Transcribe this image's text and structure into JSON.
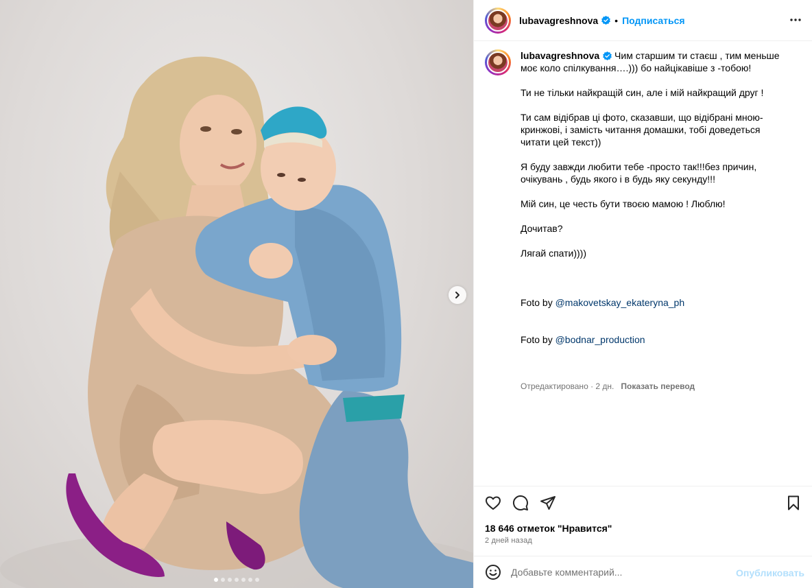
{
  "post": {
    "author": "lubavagreshnova",
    "follow_label": "Подписаться",
    "separator": "•",
    "caption": {
      "first_line": "Чим старшим ти стаєш , тим меньше моє коло спілкування….))) бо найцікавіше з -тобою!",
      "paragraphs": [
        "Ти не тільки найкращій син, але і мій найкращий друг !",
        "Ти сам відібрав ці фото, сказавши, що відібрані мною- кринжові, і замість читання домашки, тобі доведеться читати цей текст))",
        "Я буду завжди любити тебе -просто так!!!без причин, очікувань , будь якого і в будь яку секунду!!!",
        "Мій син, це честь бути твоєю мамою ! Люблю!",
        "Дочитав?",
        "Лягай спати))))"
      ],
      "credits": [
        {
          "prefix": "Foto by ",
          "mention": "@makovetskay_ekateryna_ph"
        },
        {
          "prefix": "Foto by ",
          "mention": "@bodnar_production"
        }
      ],
      "edited_label": "Отредактировано · 2 дн.",
      "translate_label": "Показать перевод"
    },
    "likes_label": "18 646 отметок \"Нравится\"",
    "date_label": "2 дней назад",
    "comment": {
      "placeholder": "Добавьте комментарий...",
      "publish_label": "Опубликовать"
    },
    "carousel": {
      "count": 7,
      "active": 0
    },
    "colors": {
      "accent": "#0095f6",
      "mention": "#00376b",
      "muted": "#737373",
      "publish_disabled": "#b2dffc",
      "verified": "#0095f6"
    },
    "icons": [
      "verified-icon",
      "more-icon",
      "heart-icon",
      "comment-icon",
      "share-icon",
      "bookmark-icon",
      "emoji-icon",
      "chevron-right-icon"
    ]
  }
}
